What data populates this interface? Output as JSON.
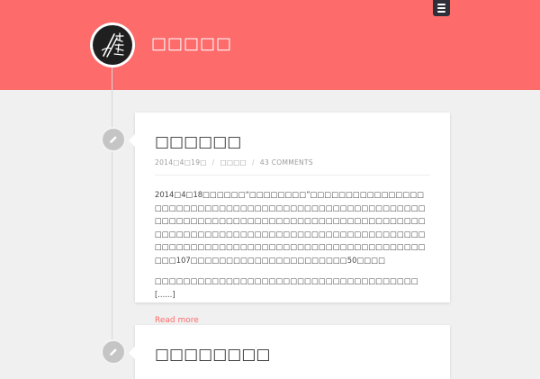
{
  "site": {
    "title": "□□□□□",
    "menu_icon": "hamburger-menu-icon",
    "avatar_icon": "calligraphy-logo-icon"
  },
  "colors": {
    "header": "#fe6b6b",
    "accent": "#fe6b6b",
    "background": "#f0f0f0",
    "menu_button": "#2d3039"
  },
  "posts": [
    {
      "icon": "pencil-icon",
      "title": "□□□□□□",
      "date": "2014□4□19□",
      "author": "□□□□",
      "comments": "43 COMMENTS",
      "paragraphs": [
        "2014□4□18□□□□□□“□□□□□□□□”□□□□□□□□□□□□□□□□□□□□□□□□□□□□□□□□□□□□□□□□□□□□□□□□□□□□□□□□□□□□□□□□□□□□□□□□□□□□□□□□□□□□□□□□□□□□□□□□□□□□□□□□□□□□□□□□□□□□□□□□□□□□□□□□□□□□□□□□□□□□□□□□□□□□□□□□□□□□□□□□□□□□□□□□□□□107□□□□□□□□□□□□□□□□□□□□□□50□□□□",
        "□□□□□□□□□□□□□□□□□□□□□□□□□□□□□□□□□□□□□[......]"
      ],
      "read_more": "Read more"
    },
    {
      "icon": "pencil-icon",
      "title": "□□□□□□□□"
    }
  ]
}
